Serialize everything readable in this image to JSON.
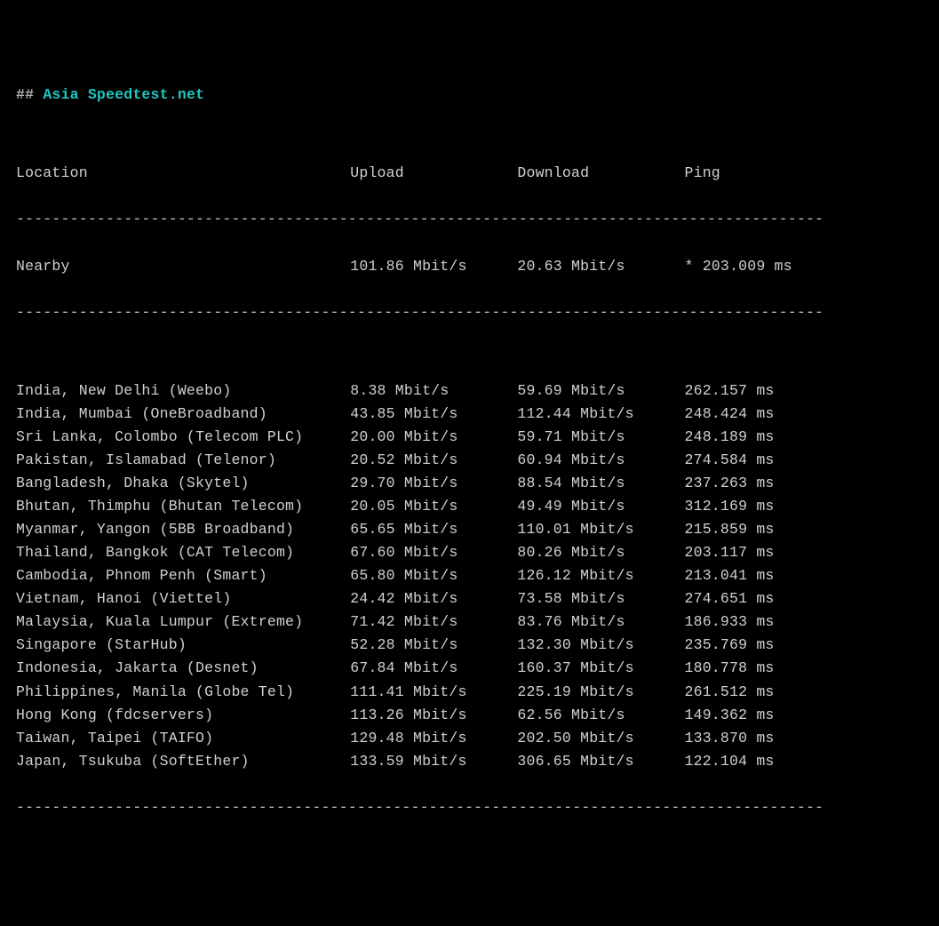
{
  "title_prefix": "## ",
  "title_text": "Asia Speedtest.net",
  "headers": {
    "location": "Location",
    "upload": "Upload",
    "download": "Download",
    "ping": "Ping"
  },
  "divider": "------------------------------------------------------------------------------------------",
  "nearby": {
    "location": "Nearby",
    "upload": "101.86 Mbit/s",
    "download": "20.63 Mbit/s",
    "ping": "* 203.009 ms"
  },
  "rows": [
    {
      "location": "India, New Delhi (Weebo)",
      "upload": "8.38 Mbit/s",
      "download": "59.69 Mbit/s",
      "ping": "262.157 ms"
    },
    {
      "location": "India, Mumbai (OneBroadband)",
      "upload": "43.85 Mbit/s",
      "download": "112.44 Mbit/s",
      "ping": "248.424 ms"
    },
    {
      "location": "Sri Lanka, Colombo (Telecom PLC)",
      "upload": "20.00 Mbit/s",
      "download": "59.71 Mbit/s",
      "ping": "248.189 ms"
    },
    {
      "location": "Pakistan, Islamabad (Telenor)",
      "upload": "20.52 Mbit/s",
      "download": "60.94 Mbit/s",
      "ping": "274.584 ms"
    },
    {
      "location": "Bangladesh, Dhaka (Skytel)",
      "upload": "29.70 Mbit/s",
      "download": "88.54 Mbit/s",
      "ping": "237.263 ms"
    },
    {
      "location": "Bhutan, Thimphu (Bhutan Telecom)",
      "upload": "20.05 Mbit/s",
      "download": "49.49 Mbit/s",
      "ping": "312.169 ms"
    },
    {
      "location": "Myanmar, Yangon (5BB Broadband)",
      "upload": "65.65 Mbit/s",
      "download": "110.01 Mbit/s",
      "ping": "215.859 ms"
    },
    {
      "location": "Thailand, Bangkok (CAT Telecom)",
      "upload": "67.60 Mbit/s",
      "download": "80.26 Mbit/s",
      "ping": "203.117 ms"
    },
    {
      "location": "Cambodia, Phnom Penh (Smart)",
      "upload": "65.80 Mbit/s",
      "download": "126.12 Mbit/s",
      "ping": "213.041 ms"
    },
    {
      "location": "Vietnam, Hanoi (Viettel)",
      "upload": "24.42 Mbit/s",
      "download": "73.58 Mbit/s",
      "ping": "274.651 ms"
    },
    {
      "location": "Malaysia, Kuala Lumpur (Extreme)",
      "upload": "71.42 Mbit/s",
      "download": "83.76 Mbit/s",
      "ping": "186.933 ms"
    },
    {
      "location": "Singapore (StarHub)",
      "upload": "52.28 Mbit/s",
      "download": "132.30 Mbit/s",
      "ping": "235.769 ms"
    },
    {
      "location": "Indonesia, Jakarta (Desnet)",
      "upload": "67.84 Mbit/s",
      "download": "160.37 Mbit/s",
      "ping": "180.778 ms"
    },
    {
      "location": "Philippines, Manila (Globe Tel)",
      "upload": "111.41 Mbit/s",
      "download": "225.19 Mbit/s",
      "ping": "261.512 ms"
    },
    {
      "location": "Hong Kong (fdcservers)",
      "upload": "113.26 Mbit/s",
      "download": "62.56 Mbit/s",
      "ping": "149.362 ms"
    },
    {
      "location": "Taiwan, Taipei (TAIFO)",
      "upload": "129.48 Mbit/s",
      "download": "202.50 Mbit/s",
      "ping": "133.870 ms"
    },
    {
      "location": "Japan, Tsukuba (SoftEther)",
      "upload": "133.59 Mbit/s",
      "download": "306.65 Mbit/s",
      "ping": "122.104 ms"
    }
  ]
}
